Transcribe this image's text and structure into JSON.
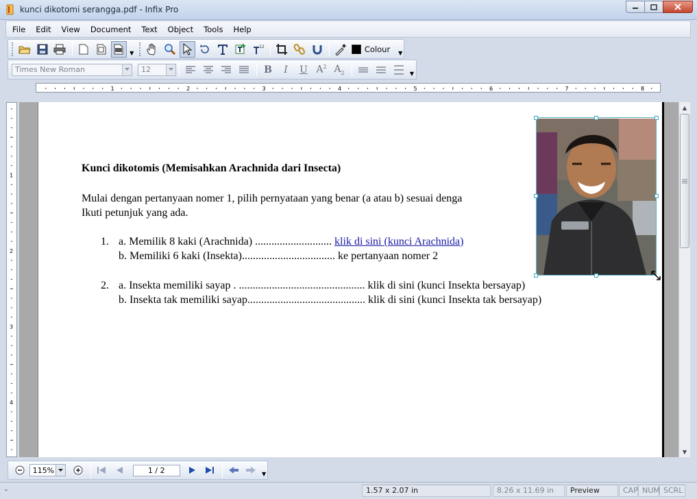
{
  "window": {
    "title": "kunci dikotomi serangga.pdf - Infix Pro"
  },
  "menu": [
    "File",
    "Edit",
    "View",
    "Document",
    "Text",
    "Object",
    "Tools",
    "Help"
  ],
  "toolbar": {
    "colour_label": "Colour",
    "colour_swatch": "#000000"
  },
  "format_bar": {
    "font_name": "Times New Roman",
    "font_size": "12"
  },
  "ruler": {
    "h_labels": [
      "1",
      "2",
      "3",
      "4",
      "5",
      "6",
      "7",
      "8"
    ],
    "v_labels": [
      "1",
      "2",
      "3",
      "4"
    ]
  },
  "document": {
    "heading": "Kunci dikotomis (Memisahkan Arachnida dari Insecta)",
    "intro_line1": "Mulai dengan pertanyaan nomer 1, pilih pernyataan yang benar (a atau b) sesuai denga",
    "intro_line2": "Ikuti petunjuk yang ada.",
    "q1_num": "1.",
    "q1_a_text": "a. Memilik 8 kaki (Arachnida) ............................",
    "q1_a_link": "klik di sini (kunci Arachnida)",
    "q1_b_text": "b. Memiliki 6 kaki (Insekta).................................. ke pertanyaan nomer 2",
    "q2_num": "2.",
    "q2_a_text": "a. Insekta memiliki sayap . .............................................. klik di sini (kunci Insekta bersayap)",
    "q2_b_text": "b. Insekta tak memiliki sayap........................................... klik di sini (kunci Insekta tak bersayap)"
  },
  "navbar": {
    "zoom": "115%",
    "page": "1 / 2"
  },
  "status": {
    "left": "-",
    "selection_size": "1.57 x 2.07 in",
    "page_size": "8.26 x 11.69 in",
    "mode": "Preview",
    "cap": "CAP",
    "num": "NUM",
    "scrl": "SCRL"
  }
}
